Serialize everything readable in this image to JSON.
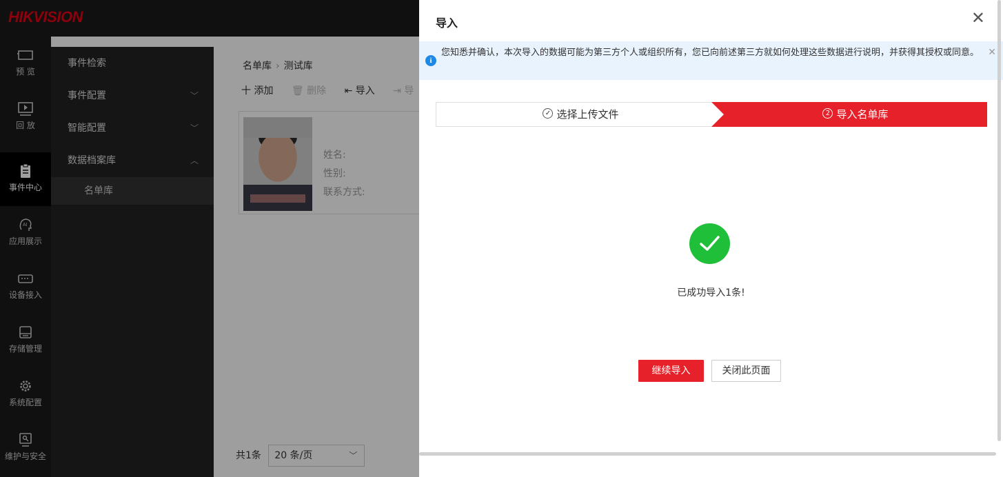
{
  "app": {
    "logo": "HIKVISION",
    "brand_color": "#e60012"
  },
  "leftnav": [
    {
      "label": "预 览",
      "icon": "monitor-icon"
    },
    {
      "label": "回 放",
      "icon": "playback-icon"
    },
    {
      "label": "事件中心",
      "icon": "clipboard-icon",
      "active": true
    },
    {
      "label": "应用展示",
      "icon": "ai-head-icon"
    },
    {
      "label": "设备接入",
      "icon": "device-icon"
    },
    {
      "label": "存储管理",
      "icon": "storage-icon"
    },
    {
      "label": "系统配置",
      "icon": "gear-icon"
    },
    {
      "label": "维护与安全",
      "icon": "shield-icon"
    }
  ],
  "submenu": {
    "items": [
      {
        "label": "事件检索"
      },
      {
        "label": "事件配置",
        "chevron": "down"
      },
      {
        "label": "智能配置",
        "chevron": "down"
      },
      {
        "label": "数据档案库",
        "chevron": "up"
      }
    ],
    "child": "名单库"
  },
  "main": {
    "breadcrumb": {
      "root": "名单库",
      "current": "测试库"
    },
    "toolbar": {
      "add": "十 添加",
      "delete": "删除",
      "import": "导入",
      "export": "导"
    },
    "card_fields": {
      "name": "姓名:",
      "gender": "性别:",
      "contact": "联系方式:"
    },
    "pager": {
      "total": "共1条",
      "page_size": "20 条/页"
    }
  },
  "drawer": {
    "title": "导入",
    "close": "✕",
    "notice": "您知悉并确认，本次导入的数据可能为第三方个人或组织所有，您已向前述第三方就如何处理这些数据进行说明，并获得其授权或同意。",
    "steps": [
      {
        "label": "选择上传文件",
        "marker": "✓"
      },
      {
        "label": "导入名单库",
        "marker": "2"
      }
    ],
    "success_text": "已成功导入1条!",
    "buttons": {
      "continue": "继续导入",
      "close_page": "关闭此页面"
    },
    "accent": "#e6212a",
    "success_color": "#1fbf3a"
  }
}
